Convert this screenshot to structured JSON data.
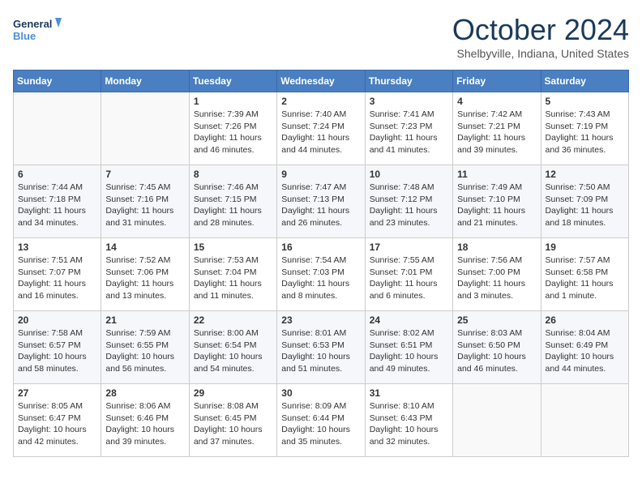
{
  "header": {
    "logo_line1": "General",
    "logo_line2": "Blue",
    "month": "October 2024",
    "location": "Shelbyville, Indiana, United States"
  },
  "weekdays": [
    "Sunday",
    "Monday",
    "Tuesday",
    "Wednesday",
    "Thursday",
    "Friday",
    "Saturday"
  ],
  "weeks": [
    [
      {
        "day": "",
        "info": ""
      },
      {
        "day": "",
        "info": ""
      },
      {
        "day": "1",
        "info": "Sunrise: 7:39 AM\nSunset: 7:26 PM\nDaylight: 11 hours and 46 minutes."
      },
      {
        "day": "2",
        "info": "Sunrise: 7:40 AM\nSunset: 7:24 PM\nDaylight: 11 hours and 44 minutes."
      },
      {
        "day": "3",
        "info": "Sunrise: 7:41 AM\nSunset: 7:23 PM\nDaylight: 11 hours and 41 minutes."
      },
      {
        "day": "4",
        "info": "Sunrise: 7:42 AM\nSunset: 7:21 PM\nDaylight: 11 hours and 39 minutes."
      },
      {
        "day": "5",
        "info": "Sunrise: 7:43 AM\nSunset: 7:19 PM\nDaylight: 11 hours and 36 minutes."
      }
    ],
    [
      {
        "day": "6",
        "info": "Sunrise: 7:44 AM\nSunset: 7:18 PM\nDaylight: 11 hours and 34 minutes."
      },
      {
        "day": "7",
        "info": "Sunrise: 7:45 AM\nSunset: 7:16 PM\nDaylight: 11 hours and 31 minutes."
      },
      {
        "day": "8",
        "info": "Sunrise: 7:46 AM\nSunset: 7:15 PM\nDaylight: 11 hours and 28 minutes."
      },
      {
        "day": "9",
        "info": "Sunrise: 7:47 AM\nSunset: 7:13 PM\nDaylight: 11 hours and 26 minutes."
      },
      {
        "day": "10",
        "info": "Sunrise: 7:48 AM\nSunset: 7:12 PM\nDaylight: 11 hours and 23 minutes."
      },
      {
        "day": "11",
        "info": "Sunrise: 7:49 AM\nSunset: 7:10 PM\nDaylight: 11 hours and 21 minutes."
      },
      {
        "day": "12",
        "info": "Sunrise: 7:50 AM\nSunset: 7:09 PM\nDaylight: 11 hours and 18 minutes."
      }
    ],
    [
      {
        "day": "13",
        "info": "Sunrise: 7:51 AM\nSunset: 7:07 PM\nDaylight: 11 hours and 16 minutes."
      },
      {
        "day": "14",
        "info": "Sunrise: 7:52 AM\nSunset: 7:06 PM\nDaylight: 11 hours and 13 minutes."
      },
      {
        "day": "15",
        "info": "Sunrise: 7:53 AM\nSunset: 7:04 PM\nDaylight: 11 hours and 11 minutes."
      },
      {
        "day": "16",
        "info": "Sunrise: 7:54 AM\nSunset: 7:03 PM\nDaylight: 11 hours and 8 minutes."
      },
      {
        "day": "17",
        "info": "Sunrise: 7:55 AM\nSunset: 7:01 PM\nDaylight: 11 hours and 6 minutes."
      },
      {
        "day": "18",
        "info": "Sunrise: 7:56 AM\nSunset: 7:00 PM\nDaylight: 11 hours and 3 minutes."
      },
      {
        "day": "19",
        "info": "Sunrise: 7:57 AM\nSunset: 6:58 PM\nDaylight: 11 hours and 1 minute."
      }
    ],
    [
      {
        "day": "20",
        "info": "Sunrise: 7:58 AM\nSunset: 6:57 PM\nDaylight: 10 hours and 58 minutes."
      },
      {
        "day": "21",
        "info": "Sunrise: 7:59 AM\nSunset: 6:55 PM\nDaylight: 10 hours and 56 minutes."
      },
      {
        "day": "22",
        "info": "Sunrise: 8:00 AM\nSunset: 6:54 PM\nDaylight: 10 hours and 54 minutes."
      },
      {
        "day": "23",
        "info": "Sunrise: 8:01 AM\nSunset: 6:53 PM\nDaylight: 10 hours and 51 minutes."
      },
      {
        "day": "24",
        "info": "Sunrise: 8:02 AM\nSunset: 6:51 PM\nDaylight: 10 hours and 49 minutes."
      },
      {
        "day": "25",
        "info": "Sunrise: 8:03 AM\nSunset: 6:50 PM\nDaylight: 10 hours and 46 minutes."
      },
      {
        "day": "26",
        "info": "Sunrise: 8:04 AM\nSunset: 6:49 PM\nDaylight: 10 hours and 44 minutes."
      }
    ],
    [
      {
        "day": "27",
        "info": "Sunrise: 8:05 AM\nSunset: 6:47 PM\nDaylight: 10 hours and 42 minutes."
      },
      {
        "day": "28",
        "info": "Sunrise: 8:06 AM\nSunset: 6:46 PM\nDaylight: 10 hours and 39 minutes."
      },
      {
        "day": "29",
        "info": "Sunrise: 8:08 AM\nSunset: 6:45 PM\nDaylight: 10 hours and 37 minutes."
      },
      {
        "day": "30",
        "info": "Sunrise: 8:09 AM\nSunset: 6:44 PM\nDaylight: 10 hours and 35 minutes."
      },
      {
        "day": "31",
        "info": "Sunrise: 8:10 AM\nSunset: 6:43 PM\nDaylight: 10 hours and 32 minutes."
      },
      {
        "day": "",
        "info": ""
      },
      {
        "day": "",
        "info": ""
      }
    ]
  ]
}
